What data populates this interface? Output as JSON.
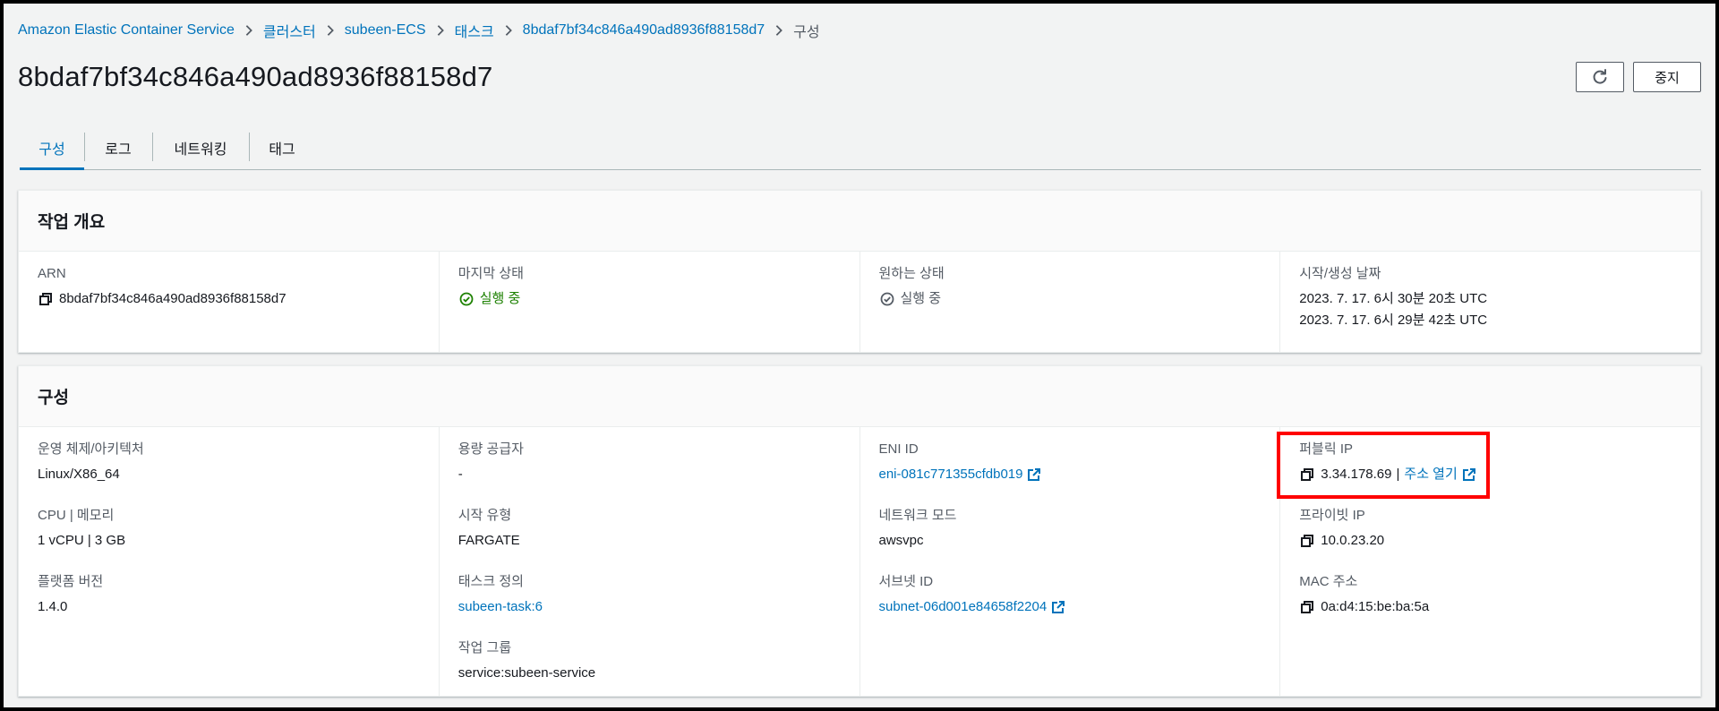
{
  "breadcrumb": [
    {
      "label": "Amazon Elastic Container Service"
    },
    {
      "label": "클러스터"
    },
    {
      "label": "subeen-ECS"
    },
    {
      "label": "태스크"
    },
    {
      "label": "8bdaf7bf34c846a490ad8936f88158d7"
    },
    {
      "label": "구성"
    }
  ],
  "title": "8bdaf7bf34c846a490ad8936f88158d7",
  "actions": {
    "stop_label": "중지",
    "refresh_icon": "refresh-icon"
  },
  "tabs": [
    {
      "label": "구성",
      "active": true
    },
    {
      "label": "로그"
    },
    {
      "label": "네트워킹"
    },
    {
      "label": "태그"
    }
  ],
  "overview": {
    "heading": "작업 개요",
    "arn": {
      "label": "ARN",
      "value": "8bdaf7bf34c846a490ad8936f88158d7"
    },
    "last_status": {
      "label": "마지막 상태",
      "value": "실행 중"
    },
    "desired_status": {
      "label": "원하는 상태",
      "value": "실행 중"
    },
    "dates": {
      "label": "시작/생성 날짜",
      "started": "2023. 7. 17. 6시 30분 20초 UTC",
      "created": "2023. 7. 17. 6시 29분 42초 UTC"
    }
  },
  "config": {
    "heading": "구성",
    "os": {
      "label": "운영 체제/아키텍처",
      "value": "Linux/X86_64"
    },
    "cpu_mem": {
      "label": "CPU | 메모리",
      "value": "1 vCPU | 3 GB"
    },
    "platform": {
      "label": "플랫폼 버전",
      "value": "1.4.0"
    },
    "capacity": {
      "label": "용량 공급자",
      "value": "-"
    },
    "launch_type": {
      "label": "시작 유형",
      "value": "FARGATE"
    },
    "task_def": {
      "label": "태스크 정의",
      "value": "subeen-task:6"
    },
    "group": {
      "label": "작업 그룹",
      "value": "service:subeen-service"
    },
    "eni": {
      "label": "ENI ID",
      "value": "eni-081c771355cfdb019"
    },
    "network_mode": {
      "label": "네트워크 모드",
      "value": "awsvpc"
    },
    "subnet": {
      "label": "서브넷 ID",
      "value": "subnet-06d001e84658f2204"
    },
    "public_ip": {
      "label": "퍼블릭 IP",
      "value": "3.34.178.69",
      "separator": "|",
      "open_label": "주소 열기"
    },
    "private_ip": {
      "label": "프라이빗 IP",
      "value": "10.0.23.20"
    },
    "mac": {
      "label": "MAC 주소",
      "value": "0a:d4:15:be:ba:5a"
    }
  },
  "colors": {
    "link": "#0073bb",
    "success": "#1d8102",
    "highlight": "#ff0000",
    "text": "#16191f",
    "muted": "#545b64"
  }
}
